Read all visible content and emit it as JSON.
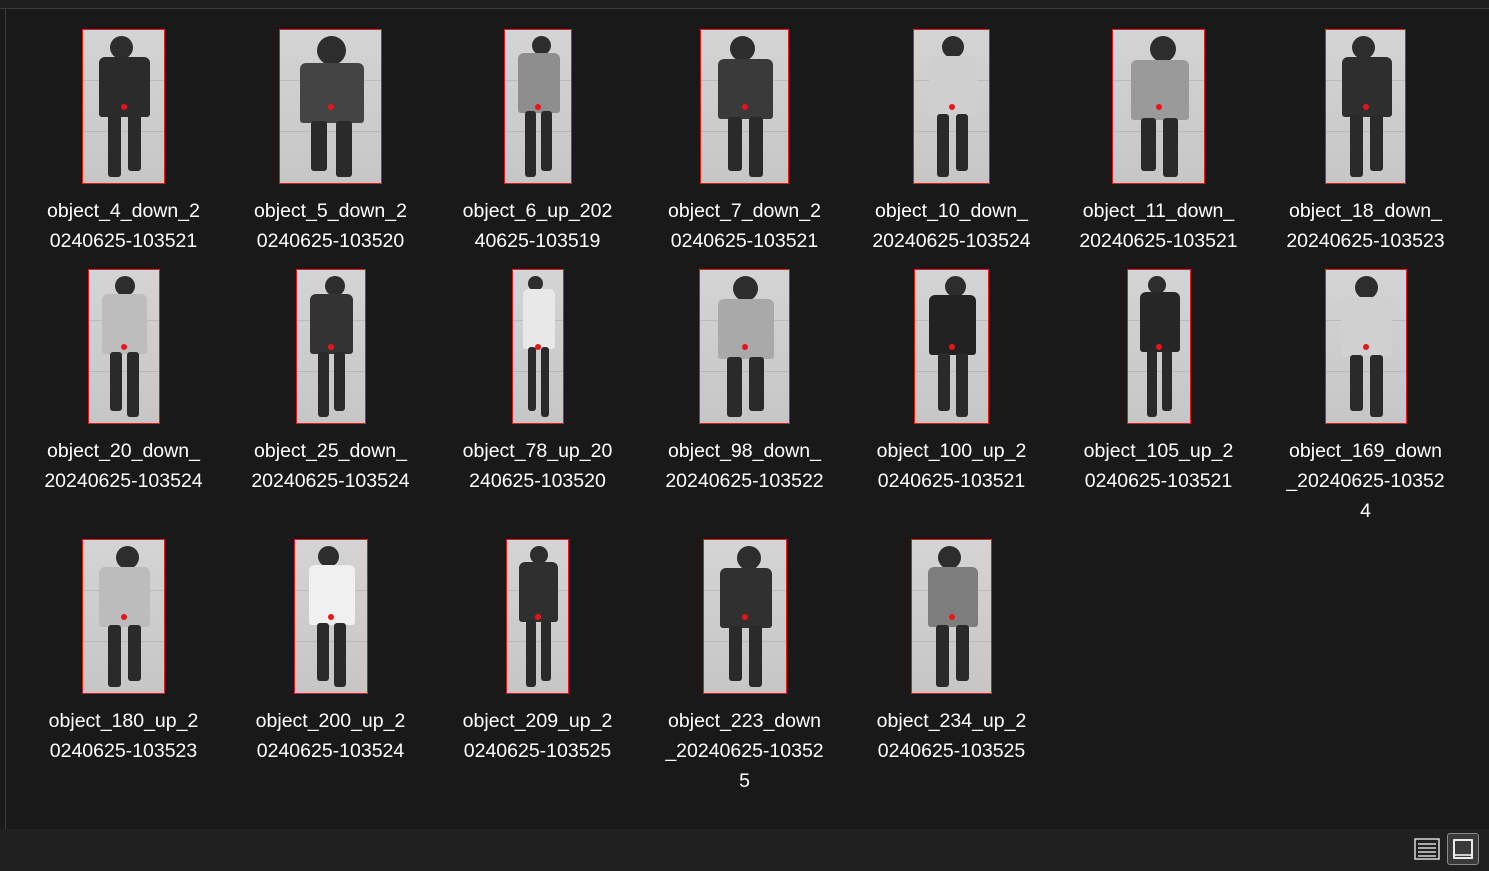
{
  "files": [
    {
      "name": "object_4_down_20240625-103521",
      "label_lines": [
        "object_4_down_2",
        "0240625-103521"
      ]
    },
    {
      "name": "object_5_down_20240625-103520",
      "label_lines": [
        "object_5_down_2",
        "0240625-103520"
      ]
    },
    {
      "name": "object_6_up_20240625-103519",
      "label_lines": [
        "object_6_up_202",
        "40625-103519"
      ]
    },
    {
      "name": "object_7_down_20240625-103521",
      "label_lines": [
        "object_7_down_2",
        "0240625-103521"
      ]
    },
    {
      "name": "object_10_down_20240625-103524",
      "label_lines": [
        "object_10_down_",
        "20240625-103524"
      ]
    },
    {
      "name": "object_11_down_20240625-103521",
      "label_lines": [
        "object_11_down_",
        "20240625-103521"
      ]
    },
    {
      "name": "object_18_down_20240625-103523",
      "label_lines": [
        "object_18_down_",
        "20240625-103523"
      ]
    },
    {
      "name": "object_20_down_20240625-103524",
      "label_lines": [
        "object_20_down_",
        "20240625-103524"
      ]
    },
    {
      "name": "object_25_down_20240625-103524",
      "label_lines": [
        "object_25_down_",
        "20240625-103524"
      ]
    },
    {
      "name": "object_78_up_20240625-103520",
      "label_lines": [
        "object_78_up_20",
        "240625-103520"
      ]
    },
    {
      "name": "object_98_down_20240625-103522",
      "label_lines": [
        "object_98_down_",
        "20240625-103522"
      ]
    },
    {
      "name": "object_100_up_20240625-103521",
      "label_lines": [
        "object_100_up_2",
        "0240625-103521"
      ]
    },
    {
      "name": "object_105_up_20240625-103521",
      "label_lines": [
        "object_105_up_2",
        "0240625-103521"
      ]
    },
    {
      "name": "object_169_down_20240625-103524",
      "label_lines": [
        "object_169_down",
        "_20240625-10352",
        "4"
      ]
    },
    {
      "name": "object_180_up_20240625-103523",
      "label_lines": [
        "object_180_up_2",
        "0240625-103523"
      ]
    },
    {
      "name": "object_200_up_20240625-103524",
      "label_lines": [
        "object_200_up_2",
        "0240625-103524"
      ]
    },
    {
      "name": "object_209_up_20240625-103525",
      "label_lines": [
        "object_209_up_2",
        "0240625-103525"
      ]
    },
    {
      "name": "object_223_down_20240625-103525",
      "label_lines": [
        "object_223_down",
        "_20240625-10352",
        "5"
      ]
    },
    {
      "name": "object_234_up_20240625-103525",
      "label_lines": [
        "object_234_up_2",
        "0240625-103525"
      ]
    }
  ],
  "view_buttons": {
    "details": {
      "icon": "details-view-icon",
      "active": false
    },
    "large_icons": {
      "icon": "large-icons-view-icon",
      "active": true
    }
  },
  "colors": {
    "background": "#191919",
    "bbox_border": "#e0191b",
    "center_dot": "#e8141a",
    "label_text": "#ffffff"
  }
}
